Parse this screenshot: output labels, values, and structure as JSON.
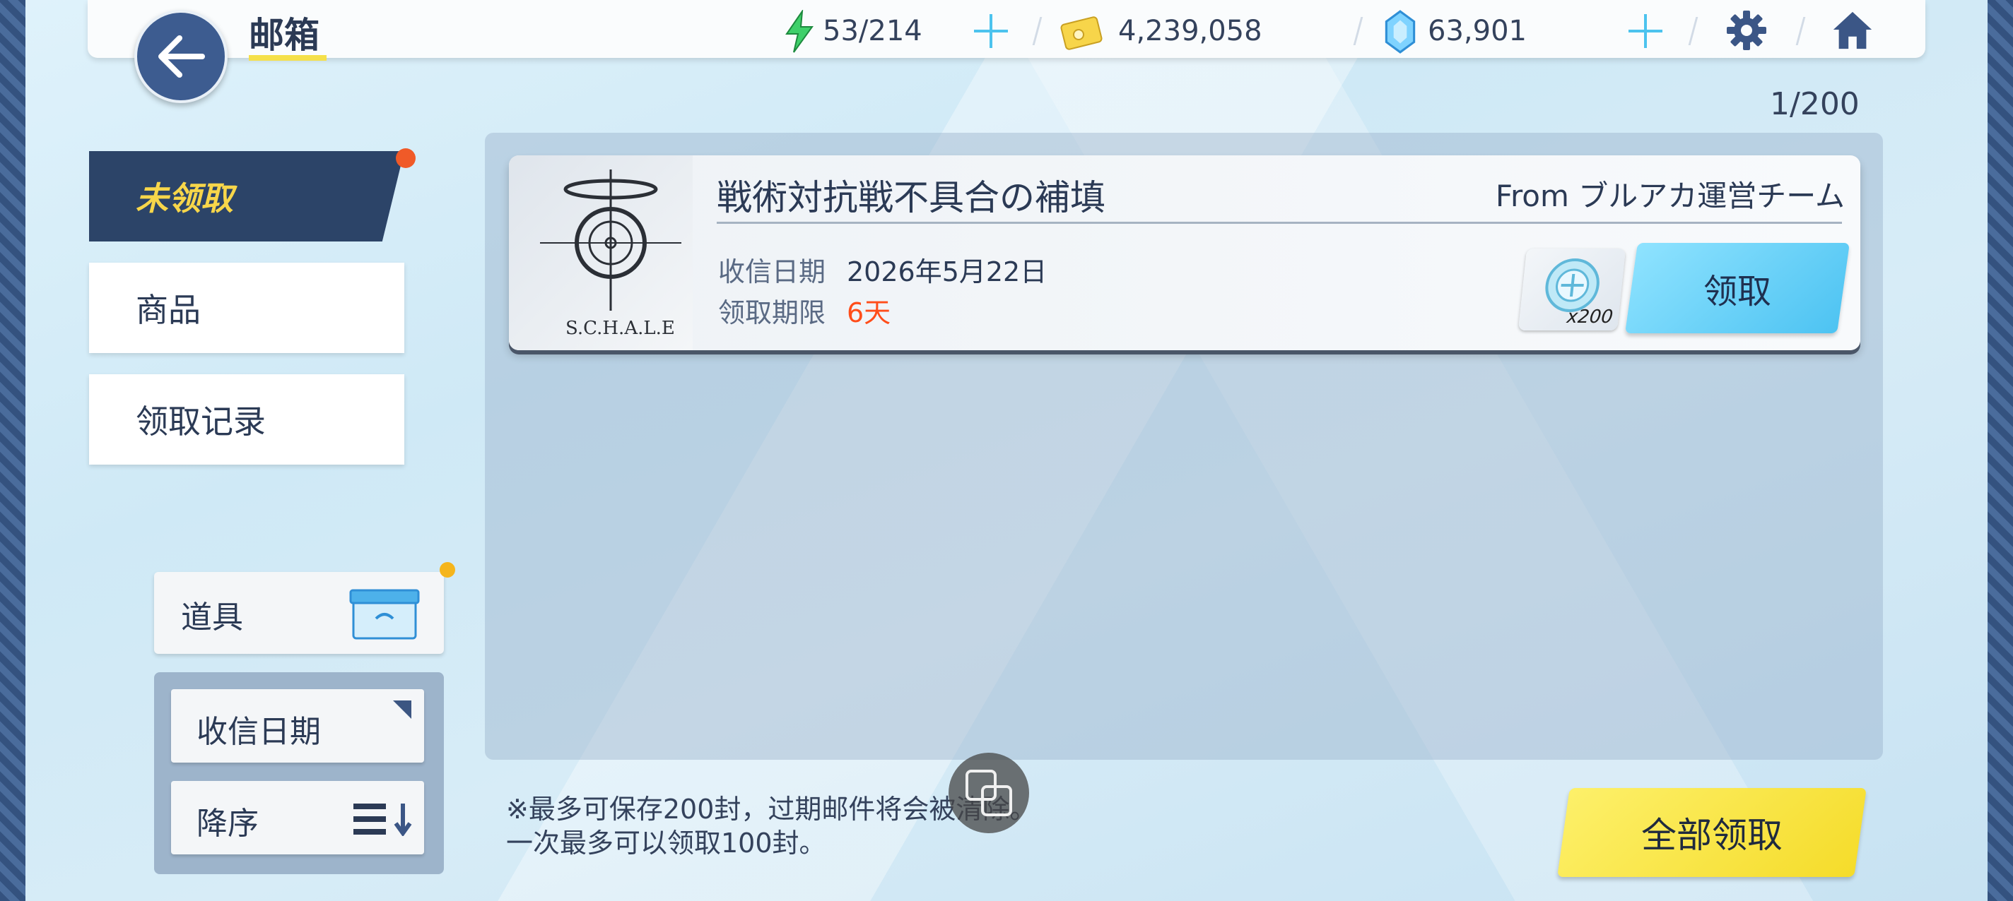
{
  "header": {
    "title": "邮箱",
    "stamina": "53/214",
    "credits": "4,239,058",
    "gems": "63,901",
    "icons": [
      "back-arrow-icon",
      "stamina-bolt-icon",
      "plus-icon",
      "credit-card-icon",
      "gem-icon",
      "gear-icon",
      "home-icon"
    ]
  },
  "mail_count": "1/200",
  "tabs": [
    {
      "label": "未领取",
      "active": true
    },
    {
      "label": "商品",
      "active": false
    },
    {
      "label": "领取记录",
      "active": false
    }
  ],
  "mail": {
    "title": "戦術対抗戦不具合の補填",
    "from": "From ブルアカ運営チーム",
    "logo_text": "S.C.H.A.L.E",
    "received_label": "收信日期",
    "received_value": "2026年5月22日",
    "expire_label": "领取期限",
    "expire_value": "6天",
    "reward_qty": "x200",
    "claim_label": "领取"
  },
  "filters": {
    "item_label": "道具",
    "sort_field": "收信日期",
    "sort_order": "降序"
  },
  "note_line1": "※最多可保存200封，过期邮件将会被清除。",
  "note_line2": "一次最多可以领取100封。",
  "claim_all_label": "全部领取",
  "colors": {
    "accent_yellow": "#f5dc2a",
    "accent_blue": "#4dc3f2",
    "navy": "#2c4468",
    "red": "#ff4d1a"
  }
}
